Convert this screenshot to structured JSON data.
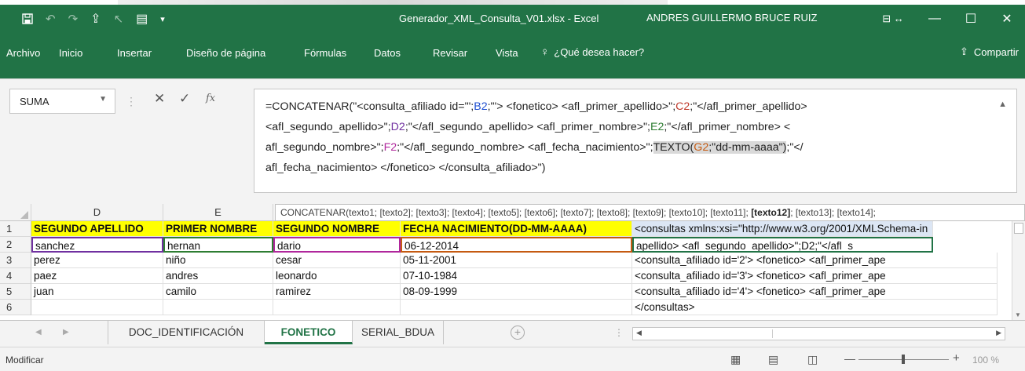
{
  "titlebar": {
    "title": "Generador_XML_Consulta_V01.xlsx  -  Excel",
    "user": "ANDRES GUILLERMO BRUCE RUIZ"
  },
  "ribbon": {
    "tabs": [
      "Archivo",
      "Inicio",
      "Insertar",
      "Diseño de página",
      "Fórmulas",
      "Datos",
      "Revisar",
      "Vista"
    ],
    "tell_me": "¿Qué desea hacer?",
    "share": "Compartir"
  },
  "namebox": {
    "value": "SUMA"
  },
  "formula": {
    "p1": "=CONCATENAR(\"<consulta_afiliado id='\";",
    "r1": "B2",
    "p2": ";\"'>    <fonetico>      <afl_primer_apellido>\";",
    "r2": "C2",
    "p3": ";\"</afl_primer_apellido>",
    "p4": "<afl_segundo_apellido>\";",
    "r3": "D2",
    "p5": ";\"</afl_segundo_apellido>      <afl_primer_nombre>\";",
    "r4": "E2",
    "p6": ";\"</afl_primer_nombre>      <",
    "p7": "afl_segundo_nombre>\";",
    "r5": "F2",
    "p8": ";\"</afl_segundo_nombre>      <afl_fecha_nacimiento>\";",
    "fn": "TEXTO(",
    "r6": "G2",
    "p9": ";\"dd-mm-aaaa\")",
    "p10": ";\"</",
    "p11": "afl_fecha_nacimiento>      </fonetico> </consulta_afiliado>\")"
  },
  "tooltip": {
    "pre": "CONCATENAR(texto1; [texto2]; [texto3]; [texto4]; [texto5]; [texto6]; [texto7]; [texto8]; [texto9]; [texto10]; [texto11]; ",
    "bold": "[texto12]",
    "post": "; [texto13]; [texto14];"
  },
  "grid": {
    "columns": [
      "D",
      "E"
    ],
    "row_numbers": [
      "1",
      "2",
      "3",
      "4",
      "5",
      "6"
    ],
    "headers": [
      "SEGUNDO APELLIDO",
      "PRIMER NOMBRE",
      "SEGUNDO NOMBRE",
      "FECHA NACIMIENTO(DD-MM-AAAA)",
      "<consultas xmlns:xsi=\"http://www.w3.org/2001/XMLSchema-in"
    ],
    "rows": [
      [
        "sanchez",
        "hernan",
        "dario",
        "06-12-2014",
        "apellido>      <afl_segundo_apellido>\";D2;\"</afl_s"
      ],
      [
        "perez",
        "niño",
        "cesar",
        "05-11-2001",
        "<consulta_afiliado id='2'>      <fonetico>       <afl_primer_ape"
      ],
      [
        "paez",
        "andres",
        "leonardo",
        "07-10-1984",
        "<consulta_afiliado id='3'>      <fonetico>       <afl_primer_ape"
      ],
      [
        "juan",
        "camilo",
        "ramirez",
        "08-09-1999",
        "<consulta_afiliado id='4'>      <fonetico>       <afl_primer_ape"
      ],
      [
        "",
        "",
        "",
        "",
        "</consultas>"
      ]
    ]
  },
  "sheets": {
    "tabs": [
      "DOC_IDENTIFICACIÓN",
      "FONETICO",
      "SERIAL_BDUA"
    ],
    "active": "FONETICO"
  },
  "status": {
    "mode": "Modificar",
    "zoom": "100 %"
  },
  "colors": {
    "excel_green": "#217346",
    "header_fill": "#ffff00",
    "ref_D": "#7030a0",
    "ref_E": "#2e7d32",
    "ref_F": "#b0279c",
    "ref_G": "#c55a11"
  }
}
